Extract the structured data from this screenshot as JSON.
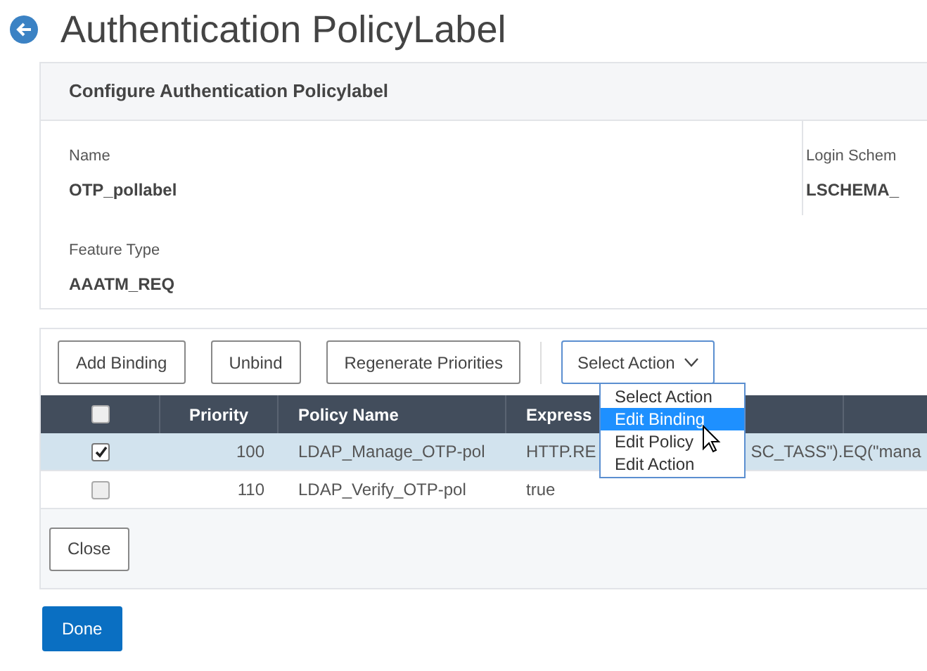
{
  "page_title": "Authentication PolicyLabel",
  "config_panel": {
    "title": "Configure Authentication Policylabel",
    "fields": [
      {
        "label": "Name",
        "value": "OTP_pollabel"
      },
      {
        "label": "Login Schem",
        "value": "LSCHEMA_"
      },
      {
        "label": "Feature Type",
        "value": "AAATM_REQ"
      }
    ]
  },
  "toolbar": {
    "buttons": [
      "Add Binding",
      "Unbind",
      "Regenerate Priorities"
    ],
    "select": {
      "value": "Select Action",
      "expanded": true,
      "options": [
        {
          "label": "Select Action",
          "highlighted": false
        },
        {
          "label": "Edit Binding",
          "highlighted": true
        },
        {
          "label": "Edit Policy",
          "highlighted": false
        },
        {
          "label": "Edit Action",
          "highlighted": false
        }
      ]
    }
  },
  "table": {
    "select_all_checked": false,
    "columns": [
      "Priority",
      "Policy Name",
      "Express"
    ],
    "rows": [
      {
        "checked": true,
        "priority": "100",
        "policy_name": "LDAP_Manage_OTP-pol",
        "expression": [
          "HTTP.RE",
          "SC_TASS\").EQ(\"mana"
        ]
      },
      {
        "checked": false,
        "priority": "110",
        "policy_name": "LDAP_Verify_OTP-pol",
        "expression": [
          "true"
        ]
      }
    ]
  },
  "close_button": "Close",
  "done_button": "Done"
}
